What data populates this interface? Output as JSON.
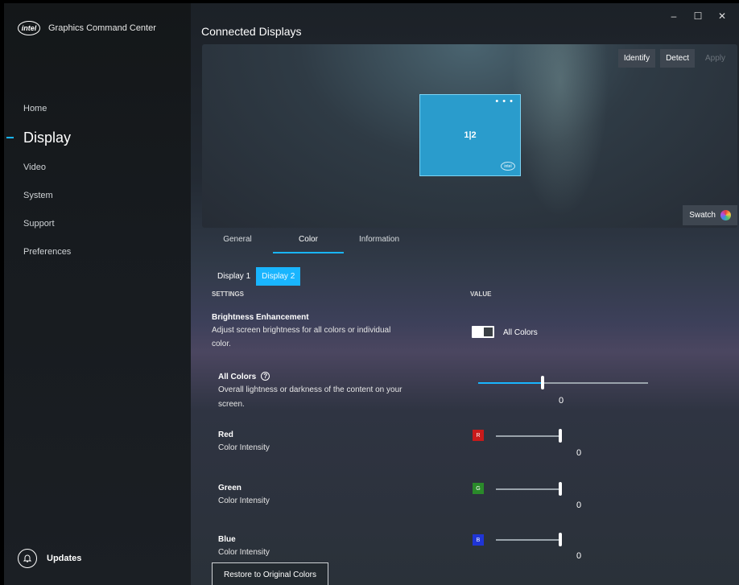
{
  "app": {
    "brand_mark": "intel",
    "title": "Graphics Command Center"
  },
  "window_controls": {
    "minimize": "–",
    "maximize": "☐",
    "close": "✕"
  },
  "sidebar": {
    "items": [
      {
        "label": "Home"
      },
      {
        "label": "Display"
      },
      {
        "label": "Video"
      },
      {
        "label": "System"
      },
      {
        "label": "Support"
      },
      {
        "label": "Preferences"
      }
    ],
    "active": "Display",
    "updates_label": "Updates"
  },
  "main": {
    "title": "Connected Displays",
    "preview": {
      "buttons": {
        "identify": "Identify",
        "detect": "Detect",
        "apply": "Apply"
      },
      "monitor_label": "1|2",
      "monitor_dots": "• • •",
      "monitor_badge": "intel",
      "swatch_label": "Swatch"
    },
    "tabs": [
      {
        "label": "General"
      },
      {
        "label": "Color"
      },
      {
        "label": "Information"
      }
    ],
    "active_tab": "Color",
    "subtabs": [
      {
        "label": "Display 1"
      },
      {
        "label": "Display 2"
      }
    ],
    "active_subtab": "Display 2",
    "columns": {
      "settings": "SETTINGS",
      "value": "VALUE"
    },
    "brightness": {
      "title": "Brightness Enhancement",
      "desc_line1": "Adjust screen brightness for all colors or individual",
      "desc_line2": "color.",
      "toggle_label": "All Colors",
      "toggle_on": true
    },
    "all_colors": {
      "title": "All Colors",
      "help": "?",
      "desc_line1": "Overall lightness or darkness of the content on your",
      "desc_line2": "screen.",
      "value": "0",
      "level": 0.38
    },
    "red": {
      "title": "Red",
      "subtitle": "Color Intensity",
      "chip": "R",
      "value": "0",
      "color": "#c81a1a",
      "level": 1.0
    },
    "green": {
      "title": "Green",
      "subtitle": "Color Intensity",
      "chip": "G",
      "value": "0",
      "color": "#2a8a2a",
      "level": 1.0
    },
    "blue": {
      "title": "Blue",
      "subtitle": "Color Intensity",
      "chip": "B",
      "value": "0",
      "color": "#1f35d6",
      "level": 1.0
    },
    "restore_button": "Restore to Original Colors"
  },
  "accent_color": "#19b5fe"
}
